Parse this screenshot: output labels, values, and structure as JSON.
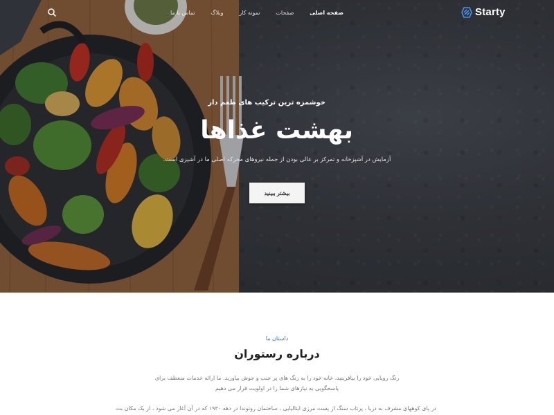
{
  "brand": {
    "name": "Starty"
  },
  "nav": {
    "items": [
      {
        "label": "صفحه اصلی",
        "active": true
      },
      {
        "label": "صفحات"
      },
      {
        "label": "نمونه کار"
      },
      {
        "label": "وبلاگ"
      },
      {
        "label": "تماس با ما"
      }
    ]
  },
  "hero": {
    "eyebrow": "خوشمزه ترین ترکیب های طعم دار",
    "title": "بهشت غذاها",
    "description": "آزمایش در آشپزخانه و تمرکز بر عالی بودن از جمله نیروهای محرکه اصلی ما در آشپزی است.",
    "cta_label": "بیشتر ببینید"
  },
  "about": {
    "kicker": "داستان ما",
    "title": "درباره رستوران",
    "paragraph1": "رنگ رویایی خود را بیافرینید، خانه خود را به رنگ های پر جنب و جوش بیاورید. ما ارائه خدمات منعطف برای پاسخگویی به نیازهای شما را در اولویت قرار می دهیم",
    "paragraph2": "در پای کوههای مشرف به دریا ، پرتاب سنگ از پست مرزی ایتالیایی ، ساختمان روتوندا در دهه ۱۹۳۰ که در آن آغاز می شود ، از یک مکان بت"
  },
  "colors": {
    "accent": "#2f6fd6",
    "hero_bg": "#383c42",
    "cta_bg": "#f4f4f4"
  },
  "icons": {
    "search": "search-icon",
    "logo": "logo-icon"
  }
}
